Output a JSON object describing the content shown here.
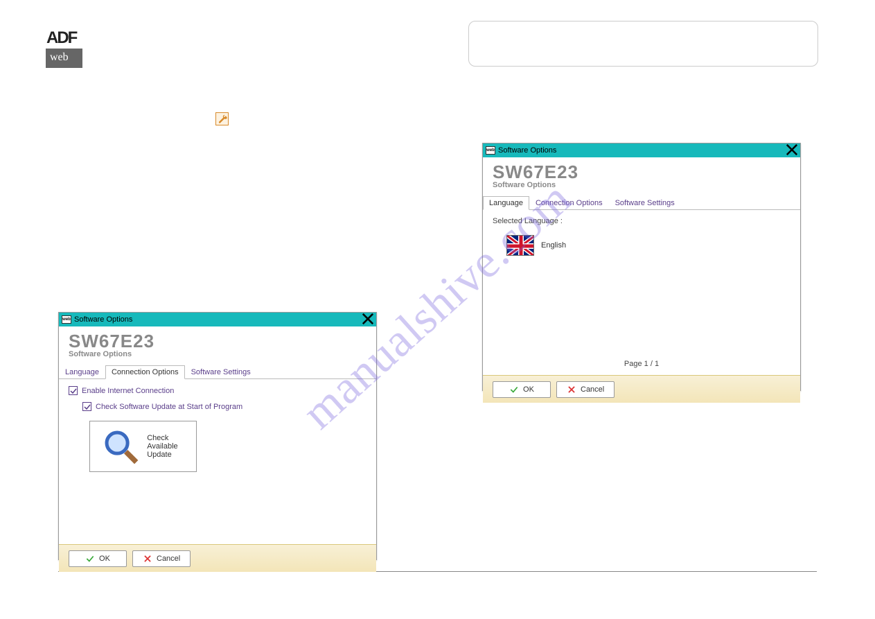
{
  "watermark": "manualshive.com",
  "dialog_a": {
    "titlebar_text": "Software Options",
    "sw_title": "SW67E23",
    "sw_sub": "Software Options",
    "tabs": {
      "language": "Language",
      "connection": "Connection Options",
      "settings": "Software Settings"
    },
    "enable_internet": "Enable Internet Connection",
    "check_update_start": "Check Software Update at Start of Program",
    "check_available": "Check Available Update",
    "ok": "OK",
    "cancel": "Cancel"
  },
  "dialog_b": {
    "titlebar_text": "Software Options",
    "sw_title": "SW67E23",
    "sw_sub": "Software Options",
    "tabs": {
      "language": "Language",
      "connection": "Connection Options",
      "settings": "Software Settings"
    },
    "selected_label": "Selected Language :",
    "lang_name": "English",
    "page": "Page 1 / 1",
    "ok": "OK",
    "cancel": "Cancel"
  }
}
